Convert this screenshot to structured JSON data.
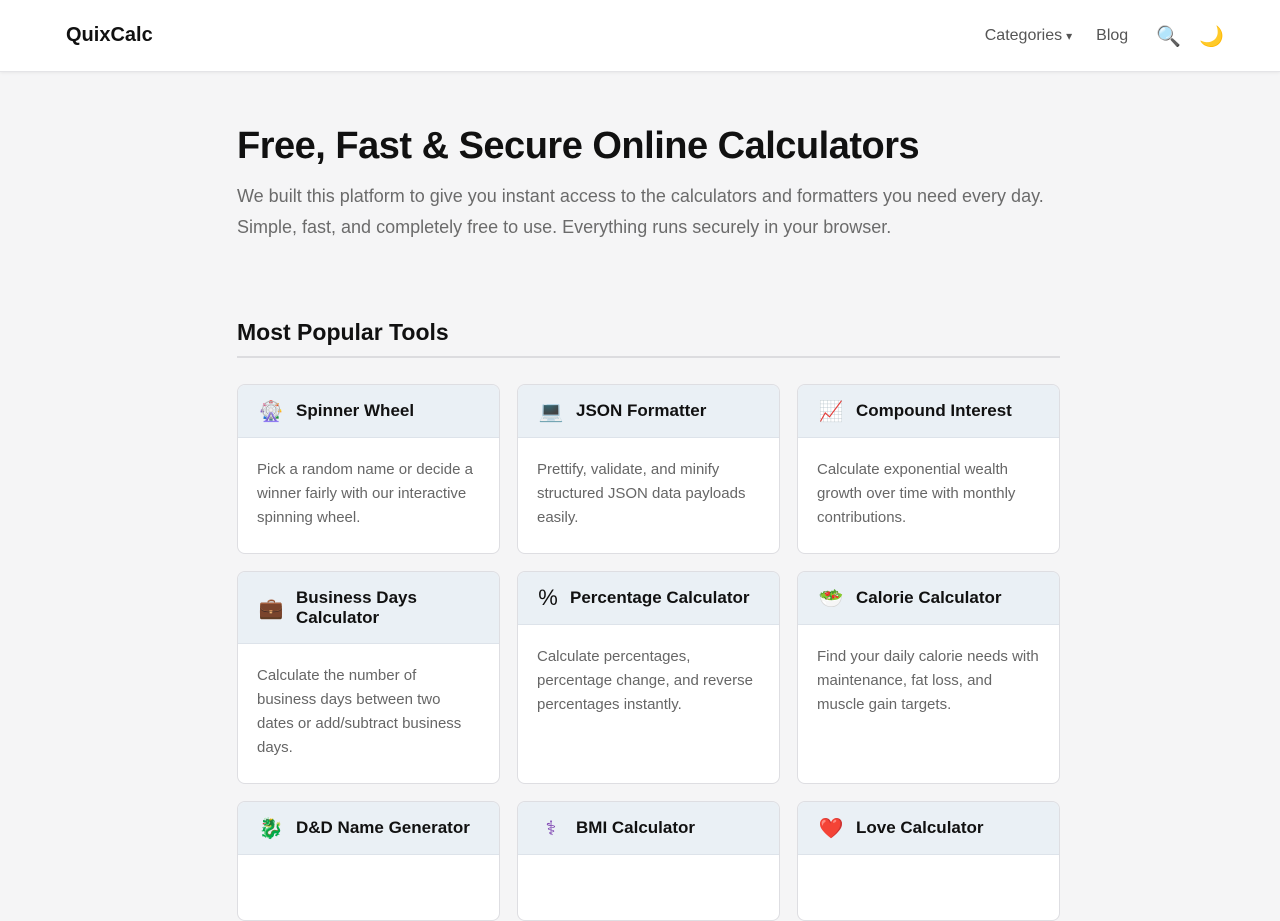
{
  "header": {
    "logo": "QuixCalc",
    "nav": {
      "categories": "Categories",
      "categories_caret": "▾",
      "blog": "Blog",
      "search_icon": "search-icon",
      "search_glyph": "🔍",
      "theme_icon": "moon-icon",
      "theme_glyph": "🌙"
    }
  },
  "hero": {
    "title": "Free, Fast & Secure Online Calculators",
    "text": "We built this platform to give you instant access to the calculators and formatters you need every day. Simple, fast, and completely free to use. Everything runs securely in your browser."
  },
  "section": {
    "title": "Most Popular Tools"
  },
  "tools": [
    {
      "icon": "🎡",
      "icon_name": "ferris-wheel-icon",
      "title": "Spinner Wheel",
      "desc": "Pick a random name or decide a winner fairly with our interactive spinning wheel."
    },
    {
      "icon": "💻",
      "icon_name": "laptop-icon",
      "title": "JSON Formatter",
      "desc": "Prettify, validate, and minify structured JSON data payloads easily."
    },
    {
      "icon": "📈",
      "icon_name": "chart-up-icon",
      "title": "Compound Interest",
      "desc": "Calculate exponential wealth growth over time with monthly contributions."
    },
    {
      "icon": "💼",
      "icon_name": "briefcase-icon",
      "title": "Business Days Calculator",
      "desc": "Calculate the number of business days between two dates or add/subtract business days."
    },
    {
      "icon": "%",
      "icon_name": "percent-icon",
      "title": "Percentage Calculator",
      "desc": "Calculate percentages, percentage change, and reverse percentages instantly."
    },
    {
      "icon": "🥗",
      "icon_name": "salad-icon",
      "title": "Calorie Calculator",
      "desc": "Find your daily calorie needs with maintenance, fat loss, and muscle gain targets."
    },
    {
      "icon": "🐉",
      "icon_name": "dragon-icon",
      "title": "D&D Name Generator",
      "desc": ""
    },
    {
      "icon": "⚕",
      "icon_name": "medical-symbol-icon",
      "title": "BMI Calculator",
      "desc": ""
    },
    {
      "icon": "❤️",
      "icon_name": "heart-icon",
      "title": "Love Calculator",
      "desc": ""
    }
  ],
  "colors": {
    "page_bg": "#f5f5f6",
    "card_head_bg": "#eaf0f5",
    "moon": "#f2b531",
    "heart": "#e0262a"
  }
}
